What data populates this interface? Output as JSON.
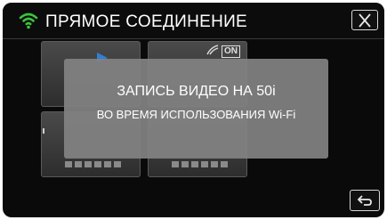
{
  "header": {
    "title": "ПРЯМОЕ СОЕДИНЕНИЕ",
    "wifi_icon": "wifi-icon",
    "close_icon": "close-icon"
  },
  "background_tiles": {
    "badge": "ON"
  },
  "popup": {
    "line1": "ЗАПИСЬ ВИДЕО НА 50i",
    "line2": "ВО ВРЕМЯ ИСПОЛЬЗОВАНИЯ Wi-Fi"
  },
  "footer": {
    "back_icon": "back-arrow-icon"
  },
  "colors": {
    "wifi": "#3cc33c",
    "background": "#0a0a0a",
    "popup": "#828282"
  }
}
